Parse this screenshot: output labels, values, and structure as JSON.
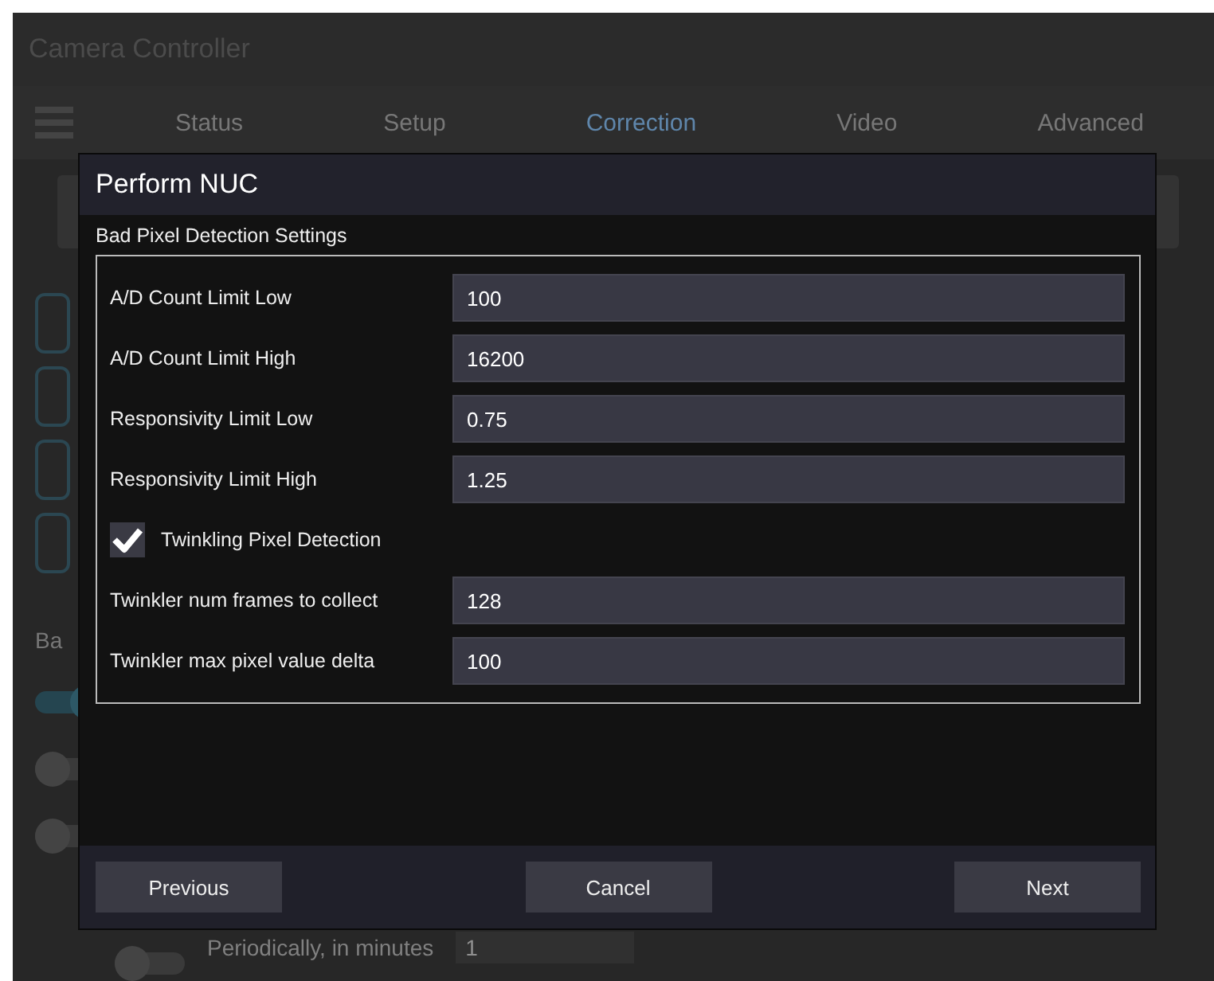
{
  "window": {
    "title": "Camera Controller"
  },
  "tabs": [
    {
      "label": "Status",
      "selected": false
    },
    {
      "label": "Setup",
      "selected": false
    },
    {
      "label": "Correction",
      "selected": true
    },
    {
      "label": "Video",
      "selected": false
    },
    {
      "label": "Advanced",
      "selected": false
    }
  ],
  "background": {
    "section_label": "Ba",
    "toggles": [
      {
        "on": true
      },
      {
        "on": false
      },
      {
        "on": false
      }
    ],
    "periodic": {
      "label": "Periodically, in minutes",
      "value": "1",
      "on": false
    }
  },
  "dialog": {
    "title": "Perform NUC",
    "section": "Bad Pixel Detection Settings",
    "rows": [
      {
        "kind": "text",
        "label": "A/D Count Limit Low",
        "value": "100"
      },
      {
        "kind": "text",
        "label": "A/D Count Limit High",
        "value": "16200"
      },
      {
        "kind": "text",
        "label": "Responsivity Limit Low",
        "value": "0.75"
      },
      {
        "kind": "text",
        "label": "Responsivity Limit High",
        "value": "1.25"
      },
      {
        "kind": "checkbox",
        "label": "Twinkling Pixel Detection",
        "checked": true
      },
      {
        "kind": "text",
        "label": "Twinkler num frames to collect",
        "value": "128"
      },
      {
        "kind": "text",
        "label": "Twinkler max pixel value delta",
        "value": "100"
      }
    ],
    "buttons": [
      "Previous",
      "Cancel",
      "Next"
    ]
  }
}
